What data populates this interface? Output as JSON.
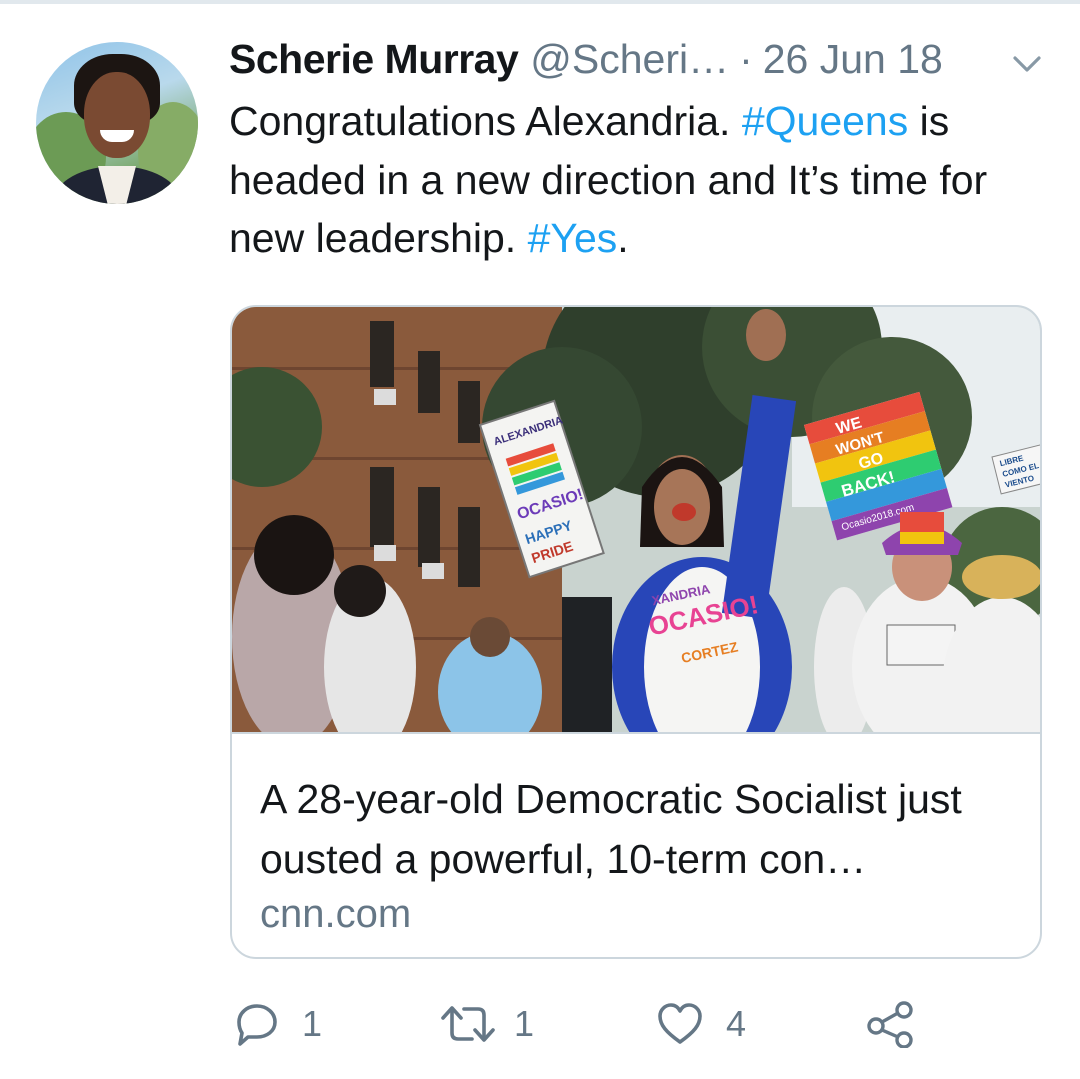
{
  "tweet": {
    "author": {
      "display_name": "Scherie Murray",
      "handle": "@Scheri…"
    },
    "separator": "·",
    "date": "26 Jun 18",
    "text_parts": {
      "p1": "Congratulations Alexandria. ",
      "hashtag1": "#Queens",
      "p2": " is headed in a new direction and It’s time for new leadership. ",
      "hashtag2": "#Yes",
      "p3": "."
    }
  },
  "card": {
    "image_signs": {
      "sign_left_lines": [
        "ALEXANDRIA",
        "OCASIO!",
        "HAPPY",
        "PRIDE"
      ],
      "sign_right_lines": [
        "WE",
        "WON'T",
        "GO",
        "BACK!",
        "Ocasio2018.com"
      ],
      "shirt_main_lines": [
        "XANDRIA",
        "OCASIO!",
        "CORTEZ"
      ],
      "small_sign_lines": [
        "LIBRE",
        "COMO EL",
        "VIENTO"
      ]
    },
    "title": "A 28-year-old Democratic Socialist just ousted a powerful, 10-term con…",
    "domain": "cnn.com"
  },
  "actions": {
    "reply_count": "1",
    "retweet_count": "1",
    "like_count": "4"
  },
  "icons": {
    "reply": "reply-icon",
    "retweet": "retweet-icon",
    "like": "heart-icon",
    "share": "share-icon",
    "menu": "chevron-down-icon"
  },
  "colors": {
    "hashtag": "#1da1f2",
    "secondary_text": "#657786",
    "border": "#ccd6dd"
  }
}
